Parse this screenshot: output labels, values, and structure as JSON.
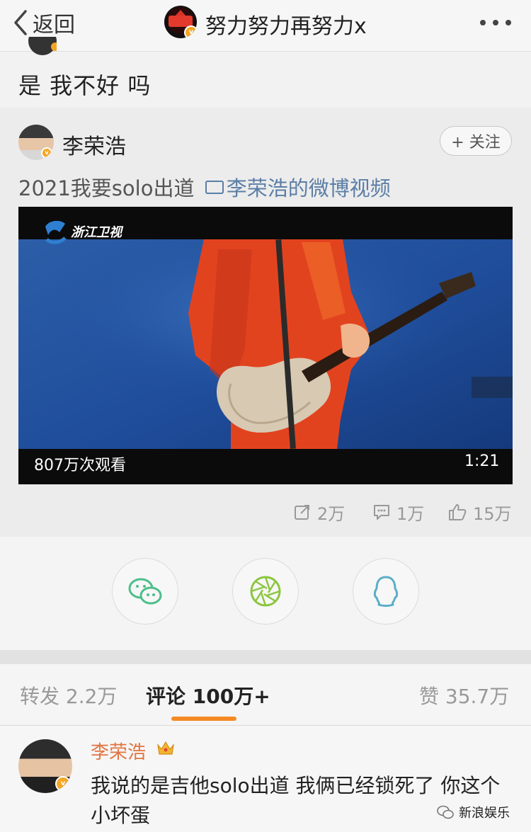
{
  "nav": {
    "back_label": "返回",
    "title": "努力努力再努力x"
  },
  "repost": {
    "text": "是 我不好 吗"
  },
  "post": {
    "author": "李荣浩",
    "follow_label": "+ 关注",
    "text": "2021我要solo出道",
    "video_link": "李荣浩的微博视频",
    "video": {
      "channel_logo": "浙江卫视",
      "views": "807万次观看",
      "duration": "1:21"
    },
    "stats": {
      "reposts": "2万",
      "comments": "1万",
      "likes": "15万"
    }
  },
  "share": {
    "targets": [
      "wechat-icon",
      "moments-icon",
      "qq-icon"
    ]
  },
  "tabs": {
    "repost": "转发 2.2万",
    "comment": "评论 100万+",
    "like": "赞 35.7万"
  },
  "comment": {
    "author": "李荣浩",
    "text": "我说的是吉他solo出道 我俩已经锁死了 你这个小坏蛋"
  },
  "watermark": "新浪娱乐",
  "colors": {
    "accent": "#f58a24",
    "link": "#5b7ea6",
    "name_orange": "#e2733e",
    "share_green": "#4cbf8a",
    "share_lime": "#8cc63f",
    "share_qq": "#5aaec6"
  }
}
